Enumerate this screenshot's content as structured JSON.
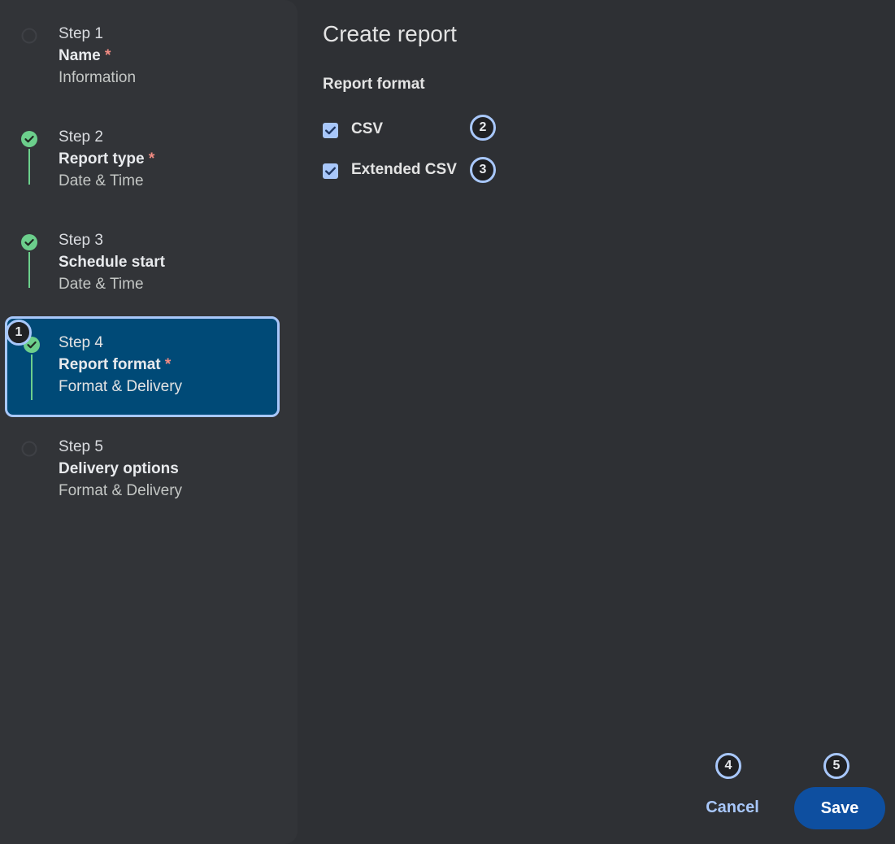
{
  "sidebar": {
    "steps": [
      {
        "num": "Step 1",
        "title": "Name",
        "required": "*",
        "sub": "Information",
        "status": "incomplete"
      },
      {
        "num": "Step 2",
        "title": "Report type",
        "required": "*",
        "sub": "Date & Time",
        "status": "complete"
      },
      {
        "num": "Step 3",
        "title": "Schedule start",
        "required": "",
        "sub": "Date & Time",
        "status": "complete"
      },
      {
        "num": "Step 4",
        "title": "Report format",
        "required": "*",
        "sub": "Format & Delivery",
        "status": "complete-active"
      },
      {
        "num": "Step 5",
        "title": "Delivery options",
        "required": "",
        "sub": "Format & Delivery",
        "status": "incomplete"
      }
    ]
  },
  "main": {
    "title": "Create report",
    "section_label": "Report format",
    "options": [
      {
        "label": "CSV",
        "checked": true
      },
      {
        "label": "Extended CSV",
        "checked": true
      }
    ],
    "cancel_label": "Cancel",
    "save_label": "Save"
  },
  "badges": [
    "1",
    "2",
    "3",
    "4",
    "5"
  ],
  "colors": {
    "background": "#2e3034",
    "sidebar": "#323438",
    "active_step": "#004a77",
    "highlight": "#a8c7fa",
    "complete": "#6ccf8c",
    "required": "#f28b82",
    "save_button": "#0e4fa0"
  }
}
